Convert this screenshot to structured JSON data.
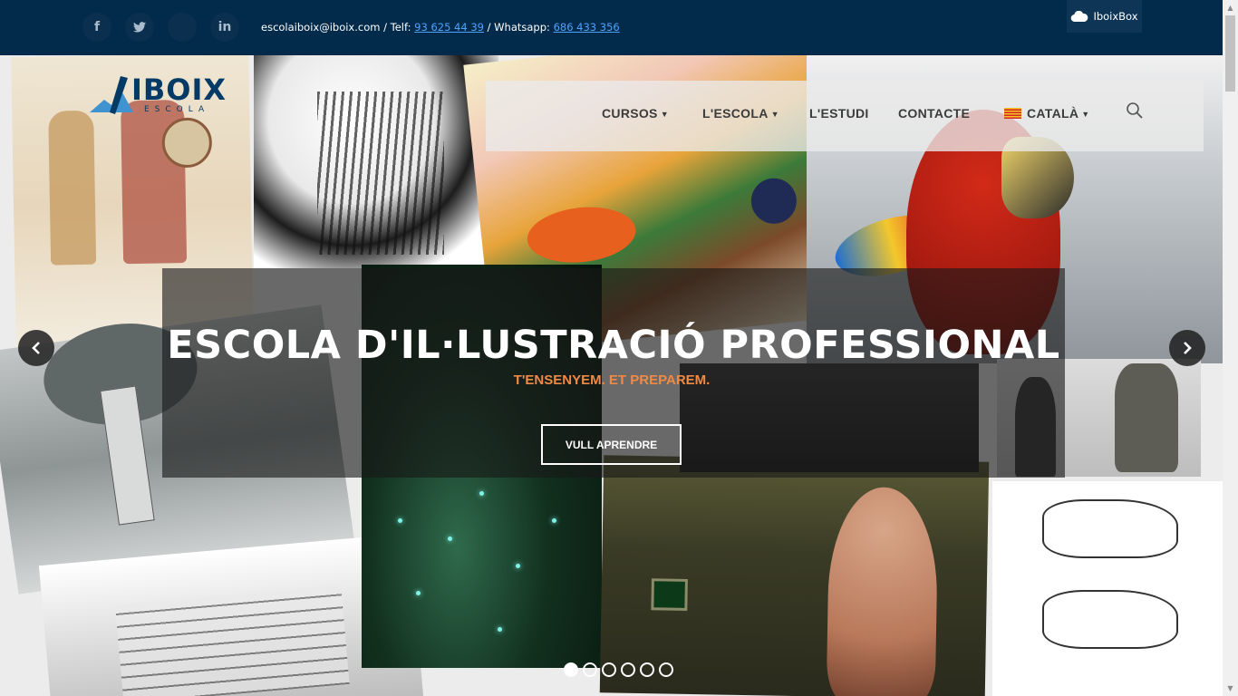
{
  "topbar": {
    "social": [
      {
        "name": "facebook",
        "glyph": "f"
      },
      {
        "name": "twitter",
        "glyph": "🐦"
      },
      {
        "name": "blank",
        "glyph": ""
      },
      {
        "name": "linkedin",
        "glyph": "in"
      }
    ],
    "email": "escolaiboix@iboix.com",
    "sep1": " / Telf: ",
    "phone": "93 625 44 39",
    "sep2": " / Whatsapp: ",
    "whatsapp": "686 433 356",
    "iboixbox_label": "IboixBox",
    "bg_color": "#022a4a"
  },
  "logo": {
    "text": "IBOIX",
    "sub": "ESCOLA"
  },
  "nav": {
    "items": [
      {
        "label": "CURSOS",
        "has_caret": true
      },
      {
        "label": "L'ESCOLA",
        "has_caret": true
      },
      {
        "label": "L'ESTUDI",
        "has_caret": false
      },
      {
        "label": "CONTACTE",
        "has_caret": false
      },
      {
        "label": "CATALÀ",
        "has_caret": true
      }
    ],
    "search_icon": "search-icon"
  },
  "slider": {
    "title": "ESCOLA D'IL·LUSTRACIÓ PROFESSIONAL",
    "subtitle": "T'ENSENYEM. ET PREPAREM.",
    "button": "VULL APRENDRE",
    "accent_color": "#f08a45",
    "prev_icon": "chevron-left-icon",
    "next_icon": "chevron-right-icon",
    "dots_count": 6,
    "active_dot": 1
  }
}
